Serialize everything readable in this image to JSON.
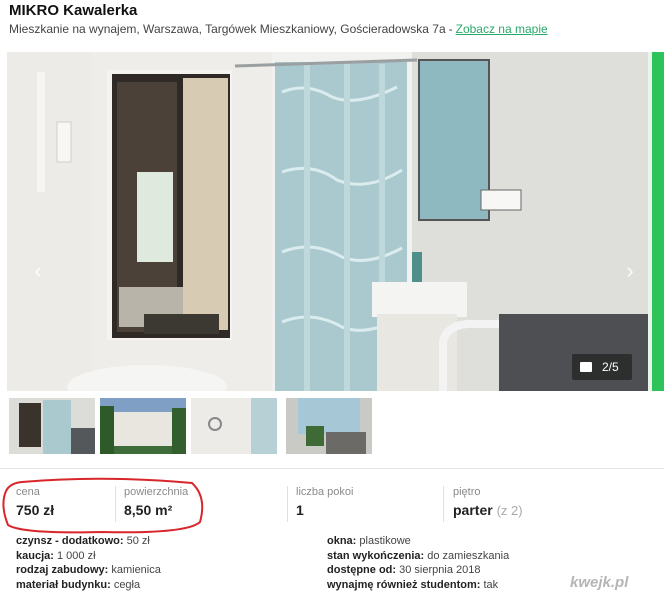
{
  "listing": {
    "title": "MIKRO Kawalerka",
    "location": "Mieszkanie na wynajem, Warszawa, Targówek Mieszkaniowy, Gościeradowska 7a",
    "separator": "-",
    "map_link": "Zobacz na mapie"
  },
  "gallery": {
    "prev_arrow": "‹",
    "next_arrow": "›",
    "counter": "2/5"
  },
  "params": [
    {
      "label": "cena",
      "value": "750 zł",
      "extra": ""
    },
    {
      "label": "powierzchnia",
      "value": "8,50 m²",
      "extra": ""
    },
    {
      "label": "liczba pokoi",
      "value": "1",
      "extra": ""
    },
    {
      "label": "piętro",
      "value": "parter",
      "extra": "(z 2)"
    }
  ],
  "details_left": [
    {
      "key": "czynsz - dodatkowo:",
      "value": "50 zł"
    },
    {
      "key": "kaucja:",
      "value": "1 000 zł"
    },
    {
      "key": "rodzaj zabudowy:",
      "value": "kamienica"
    },
    {
      "key": "materiał budynku:",
      "value": "cegła"
    }
  ],
  "details_right": [
    {
      "key": "okna:",
      "value": "plastikowe"
    },
    {
      "key": "stan wykończenia:",
      "value": "do zamieszkania"
    },
    {
      "key": "dostępne od:",
      "value": "30 sierpnia 2018"
    },
    {
      "key": "wynajmę również studentom:",
      "value": "tak"
    }
  ],
  "watermark": "kwejk.pl",
  "colors": {
    "link": "#2aa96b",
    "accent_strip": "#2ec25a",
    "annotation_circle": "#d8262b"
  }
}
